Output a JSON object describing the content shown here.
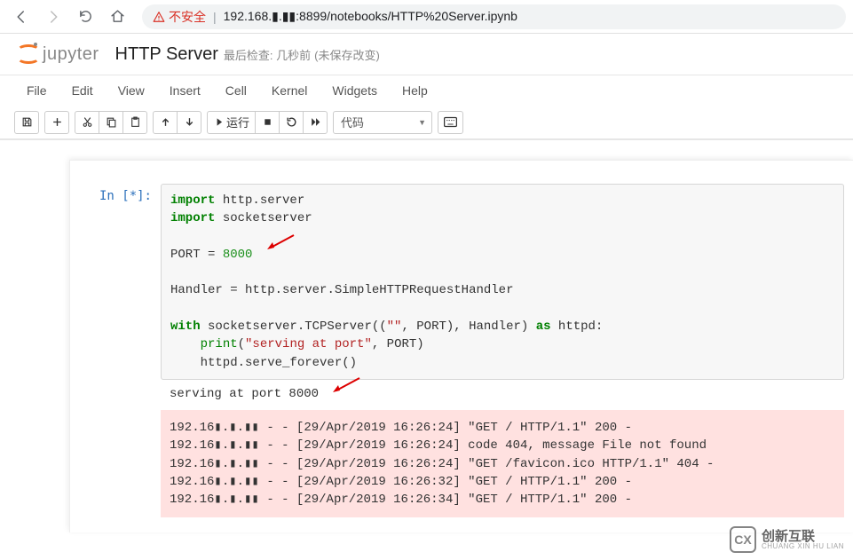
{
  "browser": {
    "security_text": "不安全",
    "url_visible": "192.168.▮.▮▮:8899/notebooks/HTTP%20Server.ipynb"
  },
  "logo_text": "jupyter",
  "notebook_title": "HTTP Server",
  "last_checkpoint_label": "最后检查:",
  "last_checkpoint_value": "几秒前",
  "autosave_status": "(未保存改变)",
  "menu": {
    "file": "File",
    "edit": "Edit",
    "view": "View",
    "insert": "Insert",
    "cell": "Cell",
    "kernel": "Kernel",
    "widgets": "Widgets",
    "help": "Help"
  },
  "toolbar": {
    "run_label": "运行",
    "celltype": "代码"
  },
  "cell": {
    "prompt": "In  [*]:",
    "code": {
      "l1a": "import",
      "l1b": " http.server",
      "l2a": "import",
      "l2b": " socketserver",
      "l3a": "PORT ",
      "l3b": "=",
      "l3c": " ",
      "l3d": "8000",
      "l4a": "Handler ",
      "l4b": "=",
      "l4c": " http.server.SimpleHTTPRequestHandler",
      "l5a": "with",
      "l5b": " socketserver.TCPServer((",
      "l5c": "\"\"",
      "l5d": ", PORT), Handler) ",
      "l5e": "as",
      "l5f": " httpd:",
      "l6a": "    ",
      "l6b": "print",
      "l6c": "(",
      "l6d": "\"serving at port\"",
      "l6e": ", PORT)",
      "l7": "    httpd.serve_forever()"
    },
    "stdout": "serving at port 8000",
    "stderr_lines": [
      "192.16▮.▮.▮▮ - - [29/Apr/2019 16:26:24] \"GET / HTTP/1.1\" 200 -",
      "192.16▮.▮.▮▮ - - [29/Apr/2019 16:26:24] code 404, message File not found",
      "192.16▮.▮.▮▮ - - [29/Apr/2019 16:26:24] \"GET /favicon.ico HTTP/1.1\" 404 -",
      "192.16▮.▮.▮▮ - - [29/Apr/2019 16:26:32] \"GET / HTTP/1.1\" 200 -",
      "192.16▮.▮.▮▮ - - [29/Apr/2019 16:26:34] \"GET / HTTP/1.1\" 200 -"
    ]
  },
  "watermark": {
    "brand": "创新互联",
    "sub": "CHUANG XIN HU LIAN"
  }
}
